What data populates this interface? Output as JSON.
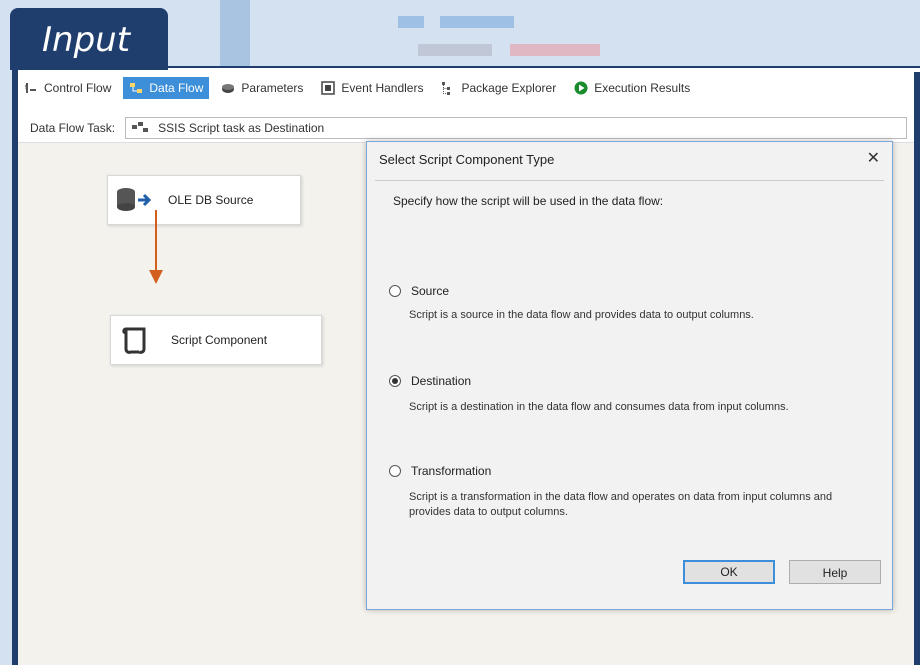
{
  "header": {
    "title": "Input"
  },
  "tabs": [
    {
      "label": "Control Flow",
      "icon": "control-flow-icon",
      "active": false
    },
    {
      "label": "Data Flow",
      "icon": "data-flow-icon",
      "active": true
    },
    {
      "label": "Parameters",
      "icon": "parameters-icon",
      "active": false
    },
    {
      "label": "Event Handlers",
      "icon": "event-handlers-icon",
      "active": false
    },
    {
      "label": "Package Explorer",
      "icon": "package-explorer-icon",
      "active": false
    },
    {
      "label": "Execution Results",
      "icon": "execution-results-icon",
      "active": false
    }
  ],
  "task": {
    "label": "Data Flow Task:",
    "value": "SSIS Script task as Destination"
  },
  "canvas": {
    "nodes": [
      {
        "label": "OLE DB Source",
        "icon": "database-source-icon"
      },
      {
        "label": "Script Component",
        "icon": "script-icon"
      }
    ]
  },
  "dialog": {
    "title": "Select Script Component Type",
    "instruction": "Specify how the script will be used in the data flow:",
    "options": [
      {
        "label": "Source",
        "description": "Script is a source in the data flow and provides data to output columns.",
        "selected": false
      },
      {
        "label": "Destination",
        "description": "Script is a destination in the data flow and consumes data from input columns.",
        "selected": true
      },
      {
        "label": "Transformation",
        "description": "Script is a transformation in the data flow and operates on data from input columns and provides data to output columns.",
        "selected": false
      }
    ],
    "ok_label": "OK",
    "help_label": "Help"
  },
  "colors": {
    "accent": "#1f3e6e",
    "active_tab": "#3c8fd8",
    "arrow": "#d35f1e"
  }
}
